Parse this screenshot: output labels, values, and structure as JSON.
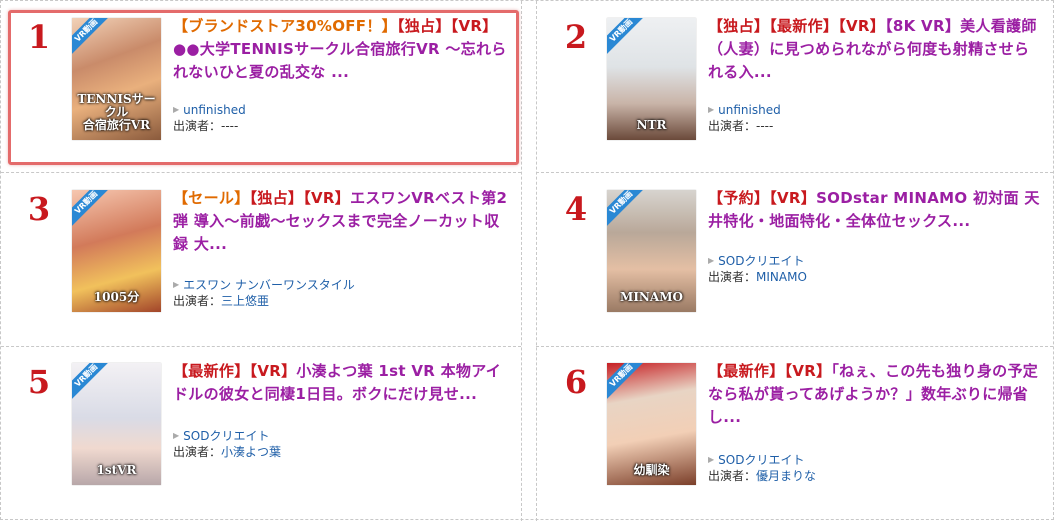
{
  "colors": {
    "accent_red": "#c8191e",
    "title_purple": "#9b1fa3",
    "tag_orange": "#e06a00",
    "link_blue": "#1f5fa8",
    "highlight_border": "#e46b6b"
  },
  "actress_label": "出演者：",
  "items": [
    {
      "rank": "1",
      "tags": [
        {
          "text": "【ブランドストア30%OFF！】",
          "kind": "orange"
        },
        {
          "text": "【独占】",
          "kind": "red"
        },
        {
          "text": "【VR】",
          "kind": "red"
        }
      ],
      "title": "●●大学TENNISサークル合宿旅行VR 〜忘れられないひと夏の乱交な ...",
      "maker": "unfinished",
      "actress": "----",
      "thumb_icon": "cover-image-tennis",
      "cover_text": "TENNISサークル\n合宿旅行VR",
      "highlighted": true
    },
    {
      "rank": "2",
      "tags": [
        {
          "text": "【独占】",
          "kind": "red"
        },
        {
          "text": "【最新作】",
          "kind": "red"
        },
        {
          "text": "【VR】",
          "kind": "red"
        }
      ],
      "title": "【8K VR】美人看護師（人妻）に見つめられながら何度も射精させられる入...",
      "maker": "unfinished",
      "actress": "----",
      "thumb_icon": "cover-image-nurse",
      "cover_text": "NTR",
      "highlighted": false
    },
    {
      "rank": "3",
      "tags": [
        {
          "text": "【セール】",
          "kind": "orange"
        },
        {
          "text": "【独占】",
          "kind": "red"
        },
        {
          "text": "【VR】",
          "kind": "red"
        }
      ],
      "title": "エスワンVRベスト第2弾 導入〜前戯〜セックスまで完全ノーカット収録 大...",
      "maker": "エスワン ナンバーワンスタイル",
      "actress": "三上悠亜",
      "thumb_icon": "cover-image-best",
      "cover_text": "1005分",
      "highlighted": false
    },
    {
      "rank": "4",
      "tags": [
        {
          "text": "【予約】",
          "kind": "red"
        },
        {
          "text": "【VR】",
          "kind": "red"
        }
      ],
      "title": "SODstar MINAMO 初対面 天井特化・地面特化・全体位セックス...",
      "maker": "SODクリエイト",
      "actress": "MINAMO",
      "thumb_icon": "cover-image-minamo",
      "cover_text": "MINAMO",
      "highlighted": false
    },
    {
      "rank": "5",
      "tags": [
        {
          "text": "【最新作】",
          "kind": "red"
        },
        {
          "text": "【VR】",
          "kind": "red"
        }
      ],
      "title": "小湊よつ葉 1st VR 本物アイドルの彼女と同棲1日目。ボクにだけ見せ...",
      "maker": "SODクリエイト",
      "actress": "小湊よつ葉",
      "thumb_icon": "cover-image-yotsuba",
      "cover_text": "1stVR",
      "highlighted": false
    },
    {
      "rank": "6",
      "tags": [
        {
          "text": "【最新作】",
          "kind": "red"
        },
        {
          "text": "【VR】",
          "kind": "red"
        }
      ],
      "title": "「ねぇ、この先も独り身の予定なら私が貰ってあげようか？」数年ぶりに帰省し...",
      "maker": "SODクリエイト",
      "actress": "優月まりな",
      "thumb_icon": "cover-image-osananajimi",
      "cover_text": "幼馴染",
      "highlighted": false
    }
  ]
}
